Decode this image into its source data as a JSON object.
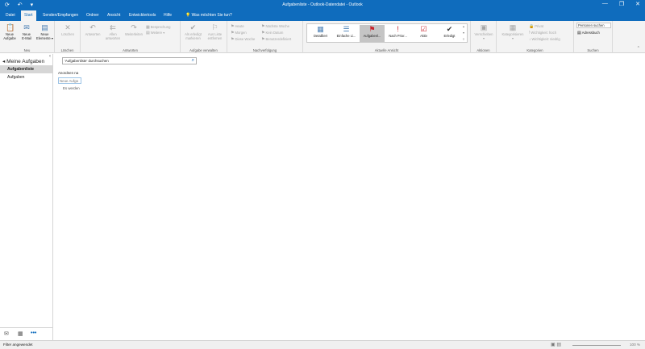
{
  "window": {
    "title": "Aufgabenliste - Outlook-Datendatei - Outlook",
    "qat": "⟳ ↶ ▾",
    "controls": [
      "—",
      "❐",
      "✕"
    ]
  },
  "tabs": [
    "Datei",
    "Start",
    "Senden/Empfangen",
    "Ordner",
    "Ansicht",
    "Entwicklertools",
    "Hilfe"
  ],
  "tell_me": "Was möchten Sie tun?",
  "ribbon": {
    "groups": {
      "new": "Neu",
      "delete": "Löschen",
      "respond": "Antworten",
      "manage": "Aufgabe verwalten",
      "followup": "Nachverfolgung",
      "current_view": "Aktuelle Ansicht",
      "actions": "Aktionen",
      "tags": "Kategorien",
      "find": "Suchen"
    },
    "new_buttons": [
      {
        "label1": "Neue",
        "label2": "Aufgabe",
        "icon": "task-icon"
      },
      {
        "label1": "Neue",
        "label2": "E-Mail",
        "icon": "mail-icon"
      },
      {
        "label1": "Neue",
        "label2": "Elemente ▾",
        "icon": "items-icon"
      }
    ],
    "delete_button": "Löschen",
    "respond_buttons": [
      {
        "label1": "Antworten",
        "label2": ""
      },
      {
        "label1": "Allen",
        "label2": "antworten"
      },
      {
        "label1": "Weiterleiten",
        "label2": ""
      }
    ],
    "respond_small": [
      "Besprechung",
      "Weitere ▾"
    ],
    "manage_buttons": [
      {
        "label1": "Als erledigt",
        "label2": "markieren"
      },
      {
        "label1": "Aus Liste",
        "label2": "entfernen"
      }
    ],
    "followup_small": [
      "Heute",
      "Morgen",
      "Diese Woche",
      "Nächste Woche",
      "Kein Datum",
      "Benutzerdefiniert"
    ],
    "views": [
      {
        "label": "Detailliert",
        "icon": "▦",
        "color": "#4a7fb5"
      },
      {
        "label": "Einfache Li...",
        "icon": "☰",
        "color": "#4a7fb5"
      },
      {
        "label": "Aufgabenl...",
        "icon": "⚑",
        "color": "#c8232c"
      },
      {
        "label": "Nach Prior...",
        "icon": "!",
        "color": "#c8232c"
      },
      {
        "label": "Aktiv",
        "icon": "☑",
        "color": "#c8232c"
      },
      {
        "label": "Erledigt",
        "icon": "✔",
        "color": "#333333"
      }
    ],
    "selected_view": 2,
    "actions_button": {
      "label1": "Verschieben",
      "label2": "▾"
    },
    "tags_button": {
      "label1": "Kategorisieren",
      "label2": "▾"
    },
    "tags_small": [
      "Privat",
      "Wichtigkeit: hoch",
      "Wichtigkeit: niedrig"
    ],
    "find_people": "Personen suchen",
    "address_book": "Adressbuch"
  },
  "sidebar": {
    "header": "Meine Aufgaben",
    "items": [
      {
        "label": "Aufgabenliste",
        "selected": true
      },
      {
        "label": "Aufgaben",
        "selected": false
      }
    ]
  },
  "main": {
    "search_placeholder": "'Aufgabenliste' durchsuchen",
    "column_header": "Anordnen na",
    "new_task_placeholder": "Neue Aufga",
    "empty_message": "Es werden"
  },
  "status": {
    "left": "Filter angewendet",
    "zoom": "100 %"
  },
  "colors": {
    "accent": "#0f6cbd",
    "ribbon_bg": "#f3f3f3",
    "selected_view_bg": "#c5c5c5"
  }
}
